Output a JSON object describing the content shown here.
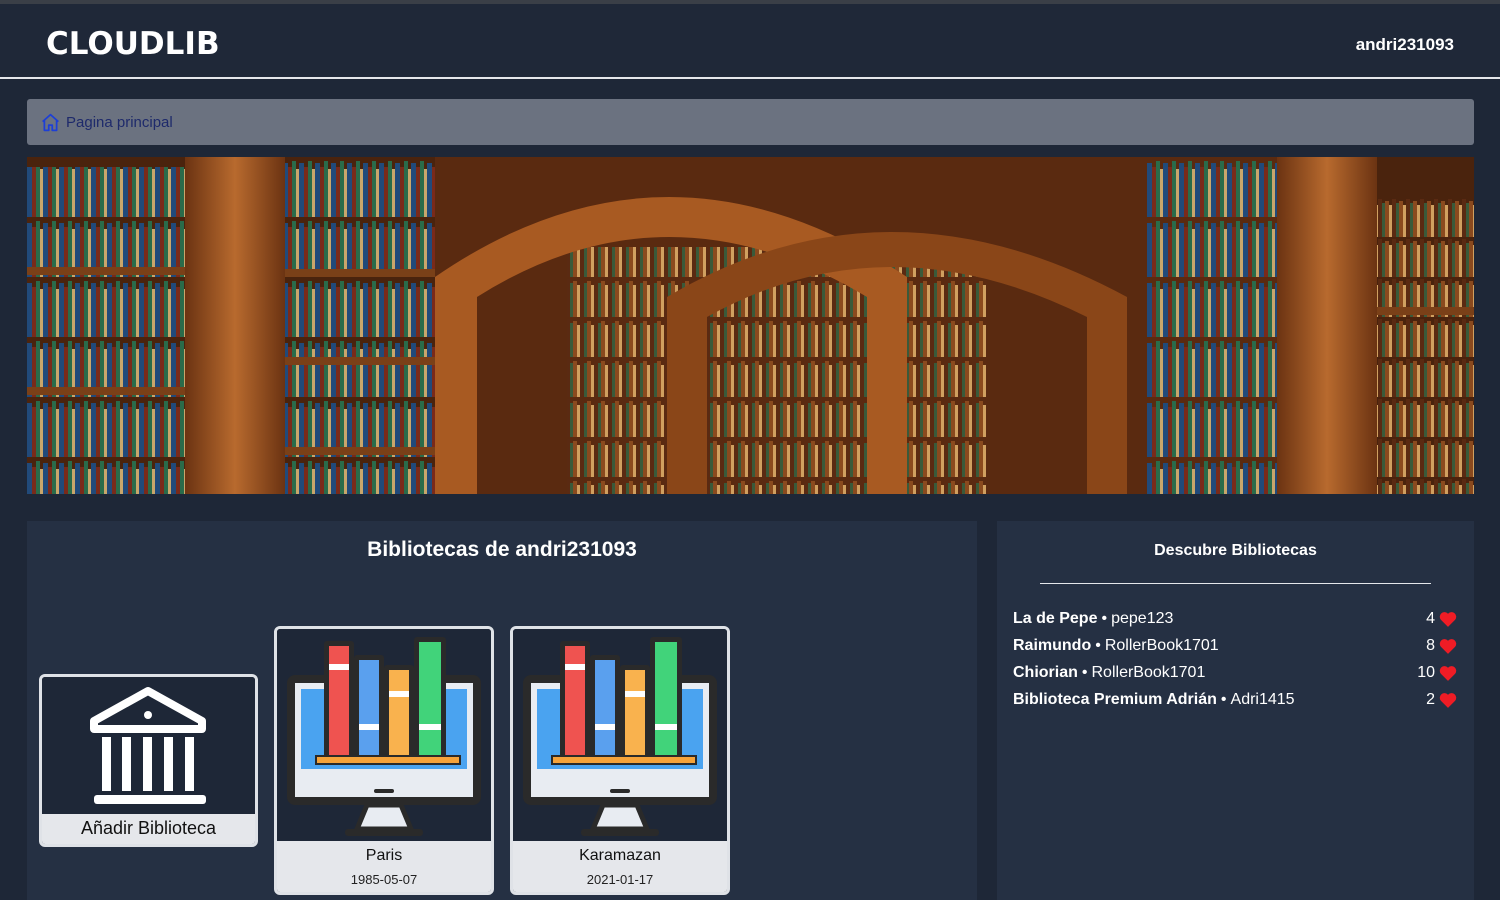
{
  "header": {
    "logo": "CLOUDLIB",
    "username": "andri231093"
  },
  "breadcrumb": {
    "home_icon": "home-icon",
    "label": "Pagina principal"
  },
  "banner": {
    "description_icon": "library-shelves-image"
  },
  "my_libraries": {
    "title": "Bibliotecas de andri231093",
    "add_card": {
      "label": "Añadir Biblioteca",
      "icon": "bank-icon"
    },
    "cards": [
      {
        "name": "Paris",
        "date": "1985-05-07",
        "icon": "books-monitor-icon"
      },
      {
        "name": "Karamazan",
        "date": "2021-01-17",
        "icon": "books-monitor-icon"
      }
    ]
  },
  "discover": {
    "title": "Descubre Bibliotecas",
    "separator": "•",
    "items": [
      {
        "name": "La de Pepe",
        "owner": "pepe123",
        "likes": "4"
      },
      {
        "name": "Raimundo",
        "owner": "RollerBook1701",
        "likes": "8"
      },
      {
        "name": "Chiorian",
        "owner": "RollerBook1701",
        "likes": "10"
      },
      {
        "name": "Biblioteca Premium Adrián",
        "owner": "Adri1415",
        "likes": "2"
      }
    ],
    "heart_color": "#ef1c25"
  }
}
